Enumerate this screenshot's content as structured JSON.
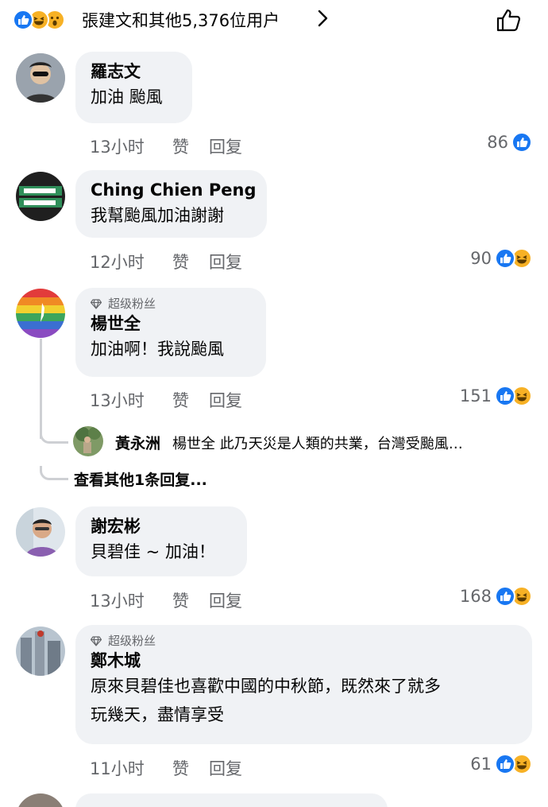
{
  "reactions_summary": {
    "label": "張建文和其他5,376位用户",
    "icons": [
      "like-icon",
      "laugh-icon",
      "wow-icon"
    ]
  },
  "comments": [
    {
      "author": "羅志文",
      "text": "加油 颱風",
      "time": "13小时",
      "like_label": "赞",
      "reply_label": "回复",
      "reaction_count": "86",
      "reaction_icons": [
        "like-icon"
      ]
    },
    {
      "author": "Ching Chien Peng",
      "text": "我幫颱風加油謝謝",
      "time": "12小时",
      "like_label": "赞",
      "reply_label": "回复",
      "reaction_count": "90",
      "reaction_icons": [
        "like-icon",
        "laugh-icon"
      ]
    },
    {
      "badge": "超级粉丝",
      "author": "楊世全",
      "text": "加油啊！我說颱風",
      "time": "13小时",
      "like_label": "赞",
      "reply_label": "回复",
      "reaction_count": "151",
      "reaction_icons": [
        "like-icon",
        "laugh-icon"
      ],
      "reply_preview": {
        "author": "黃永洲",
        "text": "楊世全  此乃天災是人類的共業，台灣受颱風…"
      },
      "more_replies_label": "查看其他1条回复..."
    },
    {
      "author": "謝宏彬",
      "text": "貝碧佳 ~ 加油！",
      "time": "13小时",
      "like_label": "赞",
      "reply_label": "回复",
      "reaction_count": "168",
      "reaction_icons": [
        "like-icon",
        "laugh-icon"
      ]
    },
    {
      "badge": "超级粉丝",
      "author": "鄭木城",
      "text_line1": "原來貝碧佳也喜歡中國的中秋節，既然來了就多",
      "text_line2": "玩幾天，盡情享受",
      "time": "11小时",
      "like_label": "赞",
      "reply_label": "回复",
      "reaction_count": "61",
      "reaction_icons": [
        "like-icon",
        "laugh-icon"
      ]
    }
  ],
  "colors": {
    "like_blue": "#1877f2",
    "reaction_yellow": "#f7b125",
    "bubble_bg": "#f0f2f5",
    "meta_gray": "#65676b"
  }
}
